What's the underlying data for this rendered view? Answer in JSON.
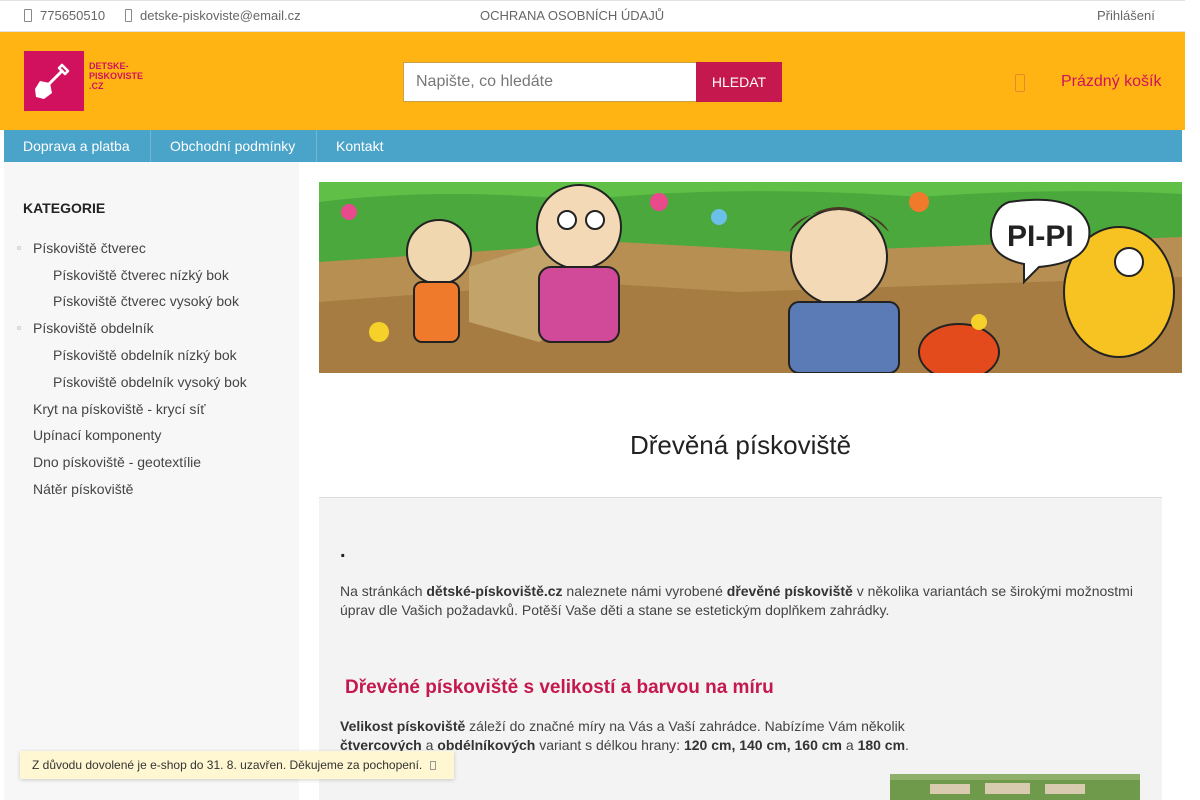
{
  "topbar": {
    "phone": "775650510",
    "email": "detske-piskoviste@email.cz",
    "privacy": "OCHRANA OSOBNÍCH ÚDAJŮ",
    "login": "Přihlášení"
  },
  "header": {
    "logo_text_line1": "DETSKE-",
    "logo_text_line2": "PISKOVISTE",
    "logo_text_line3": ".CZ",
    "search_placeholder": "Napište, co hledáte",
    "search_button": "HLEDAT",
    "cart_label": "Prázdný košík"
  },
  "nav": {
    "items": [
      "Doprava a platba",
      "Obchodní podmínky",
      "Kontakt"
    ]
  },
  "sidebar": {
    "heading": "KATEGORIE",
    "categories": [
      "Pískoviště čtverec",
      "Pískoviště čtverec nízký bok",
      "Pískoviště čtverec vysoký bok",
      "Pískoviště obdelník",
      "Pískoviště obdelník nízký bok",
      "Pískoviště obdelník vysoký bok",
      "Kryt na pískoviště - krycí síť",
      "Upínací komponenty",
      "Dno pískoviště - geotextílie",
      "Nátěr pískoviště"
    ]
  },
  "banner": {
    "speech_text": "PI-PI"
  },
  "main": {
    "title": "Dřevěná pískoviště",
    "dot": ".",
    "p1": {
      "t1": "Na stránkách ",
      "b1": "dětské-pískoviště.cz",
      "t2": " naleznete námi vyrobené ",
      "b2": "dřevěné pískoviště",
      "t3": " v několika variantách se širokými možnostmi úprav dle Vašich požadavků. Potěší Vaše děti a stane se estetickým doplňkem zahrádky."
    },
    "heading2": "Dřevěné pískoviště s velikostí a barvou na míru",
    "p2": {
      "b1": "Velikost pískoviště",
      "t1": " záleží do značné míry na Vás a Vaší zahrádce. Nabízíme Vám několik ",
      "b2": "čtvercových",
      "t2": " a ",
      "b3": "obdélníkových",
      "t3": " variant s délkou hrany: ",
      "b4": "120 cm, 140 cm, 160 cm",
      "t4": " a ",
      "b5": "180 cm",
      "t5": "."
    }
  },
  "notice": {
    "text": "Z důvodu dovolené je e-shop do 31. 8. uzavřen. Děkujeme za pochopení."
  },
  "colors": {
    "header_bg": "#ffb414",
    "brand": "#d2115e",
    "nav_bg": "#4aa3c8",
    "search_button_bg": "#c4184e"
  }
}
